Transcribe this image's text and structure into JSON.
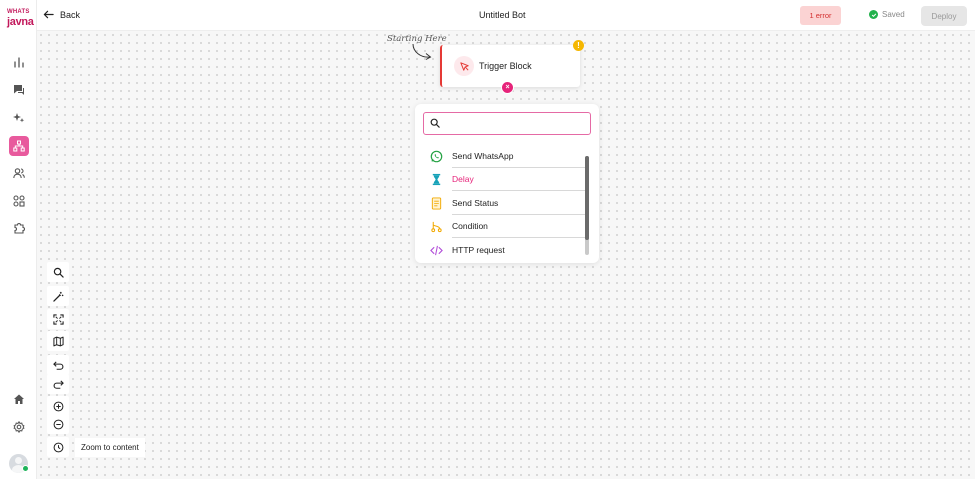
{
  "sidebar": {
    "logo_line1": "WHATS",
    "logo_line2": "javna",
    "items": [
      {
        "icon": "bar-chart-icon",
        "active": false
      },
      {
        "icon": "chat-icon",
        "active": false
      },
      {
        "icon": "sparkles-icon",
        "active": false
      },
      {
        "icon": "flow-chart-icon",
        "active": true
      },
      {
        "icon": "users-icon",
        "active": false
      },
      {
        "icon": "integrations-icon",
        "active": false
      },
      {
        "icon": "puzzle-icon",
        "active": false
      },
      {
        "icon": "home-icon",
        "active": false
      },
      {
        "icon": "settings-icon",
        "active": false
      }
    ]
  },
  "header": {
    "back_label": "Back",
    "title": "Untitled Bot",
    "error_label": "1 error",
    "saved_label": "Saved",
    "deploy_label": "Deploy"
  },
  "canvas": {
    "start_annotation": "Starting Here",
    "trigger_block": {
      "label": "Trigger Block",
      "warning": "!"
    },
    "picker": {
      "search_value": "",
      "items": [
        {
          "label": "Send WhatsApp",
          "icon": "whatsapp-icon",
          "color": "#25a244"
        },
        {
          "label": "Delay",
          "icon": "hourglass-icon",
          "color": "#17a2b8",
          "highlighted": true
        },
        {
          "label": "Send Status",
          "icon": "document-icon",
          "color": "#f2a900"
        },
        {
          "label": "Condition",
          "icon": "branch-icon",
          "color": "#f2a900"
        },
        {
          "label": "HTTP request",
          "icon": "code-icon",
          "color": "#b04ad8"
        }
      ]
    },
    "toolbar": {
      "tools": [
        "search-icon",
        "magic-wand-icon",
        "fit-screen-icon",
        "map-icon",
        "undo-icon",
        "redo-icon",
        "zoom-in-icon",
        "zoom-out-icon",
        "history-icon"
      ],
      "zoom_tooltip": "Zoom to content"
    }
  },
  "colors": {
    "brand": "#c2185b",
    "accent": "#e6247a",
    "active_nav": "#e85a9d",
    "error_bg": "#fbd3d3",
    "error_text": "#d32f2f",
    "saved_check": "#22b14c"
  }
}
